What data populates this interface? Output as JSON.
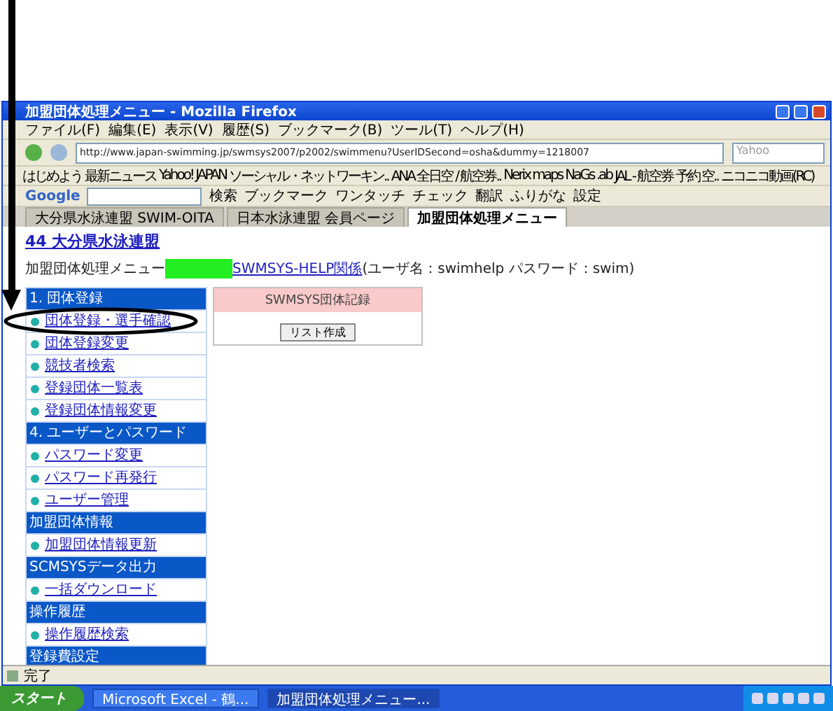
{
  "window": {
    "title": "加盟団体処理メニュー - Mozilla Firefox"
  },
  "menu_bar": [
    "ファイル(F)",
    "編集(E)",
    "表示(V)",
    "履歴(S)",
    "ブックマーク(B)",
    "ツール(T)",
    "ヘルプ(H)"
  ],
  "address_bar": {
    "url": "http://www.japan-swimming.jp/swmsys2007/p2002/swimmenu?UserIDSecond=osha&dummy=1218007",
    "search_placeholder": "Yahoo"
  },
  "bookmarks": [
    "はじめよう",
    "最新ニュース",
    "Yahoo! JAPAN",
    "ソーシャル・ネットワーキン..",
    "ANA 全日空",
    "/ 航空券..",
    "Nerix maps",
    "NaGs .ab",
    "JAL - 航空券 予約 空..",
    "ニコニコ動画(RC)"
  ],
  "google_toolbar": {
    "logo": "Google",
    "items": [
      "検索",
      "ブックマーク",
      "ワンタッチ",
      "チェック",
      "翻訳",
      "ふりがな",
      "設定"
    ]
  },
  "tabs": [
    {
      "label": "大分県水泳連盟 SWIM-OITA",
      "selected": false
    },
    {
      "label": "日本水泳連盟 会員ページ",
      "selected": false
    },
    {
      "label": "加盟団体処理メニュー",
      "selected": true
    }
  ],
  "page": {
    "site_link": "44 大分県水泳連盟",
    "menu_title": "加盟団体処理メニュー",
    "help_link": "SWMSYS-HELP関係",
    "help_note": "(ユーザ名：swimhelp パスワード：swim)"
  },
  "sidebar": [
    {
      "kind": "header",
      "label": "1. 団体登録"
    },
    {
      "kind": "item",
      "label": "団体登録・選手確認"
    },
    {
      "kind": "item",
      "label": "団体登録変更"
    },
    {
      "kind": "item",
      "label": "競技者検索"
    },
    {
      "kind": "item",
      "label": "登録団体一覧表"
    },
    {
      "kind": "item",
      "label": "登録団体情報変更"
    },
    {
      "kind": "header",
      "label": "4. ユーザーとパスワード"
    },
    {
      "kind": "item",
      "label": "パスワード変更"
    },
    {
      "kind": "item",
      "label": "パスワード再発行"
    },
    {
      "kind": "item",
      "label": "ユーザー管理"
    },
    {
      "kind": "header",
      "label": "加盟団体情報"
    },
    {
      "kind": "item",
      "label": "加盟団体情報更新"
    },
    {
      "kind": "header",
      "label": "SCMSYSデータ出力"
    },
    {
      "kind": "item",
      "label": "一括ダウンロード"
    },
    {
      "kind": "header",
      "label": "操作履歴"
    },
    {
      "kind": "item",
      "label": "操作履歴検索"
    },
    {
      "kind": "header",
      "label": "登録費設定"
    }
  ],
  "panel": {
    "title": "SWMSYS団体記録",
    "button": "リスト作成"
  },
  "status_bar": "完了",
  "taskbar": {
    "start": "スタート",
    "tasks": [
      {
        "label": "Microsoft Excel - 鶴...",
        "selected": false
      },
      {
        "label": "加盟団体処理メニュー...",
        "selected": true
      }
    ]
  }
}
